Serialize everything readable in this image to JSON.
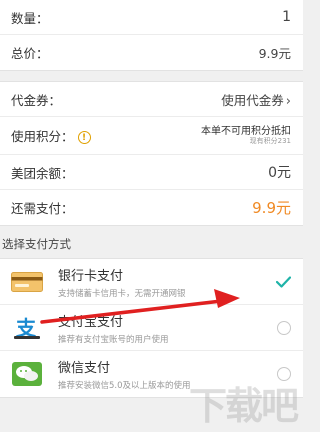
{
  "summary": {
    "quantity_label": "数量：",
    "quantity_value": "1",
    "total_label": "总价：",
    "total_value": "9.9元"
  },
  "discounts": {
    "voucher_label": "代金券：",
    "voucher_value": "使用代金券",
    "points_label": "使用积分：",
    "points_value": "本单不可用积分抵扣",
    "points_sub": "现有积分231",
    "balance_label": "美团余额：",
    "balance_value": "0元",
    "due_label": "还需支付：",
    "due_value": "9.9元"
  },
  "payment": {
    "section_title": "选择支付方式",
    "methods": [
      {
        "title": "银行卡支付",
        "desc": "支持储蓄卡信用卡，无需开通网银",
        "selected": true,
        "icon": "bank-card-icon"
      },
      {
        "title": "支付宝支付",
        "desc": "推荐有支付宝账号的用户使用",
        "selected": false,
        "icon": "alipay-icon"
      },
      {
        "title": "微信支付",
        "desc": "推荐安装微信5.0及以上版本的使用",
        "selected": false,
        "icon": "wechat-icon"
      }
    ]
  },
  "watermark": "下载吧",
  "colors": {
    "accent_orange": "#f08a24",
    "check_teal": "#1fb3a8",
    "annotation_red": "#e02020"
  }
}
